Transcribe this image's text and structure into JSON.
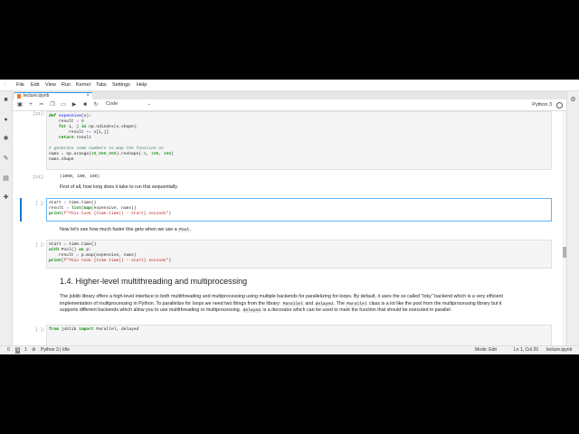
{
  "menubar": {
    "items": [
      "File",
      "Edit",
      "View",
      "Run",
      "Kernel",
      "Tabs",
      "Settings",
      "Help"
    ]
  },
  "tab": {
    "label": "lecture.ipynb",
    "close": "×"
  },
  "toolbar": {
    "cell_type": "Code",
    "kernel": "Python 3"
  },
  "cells": {
    "c1_prompt": "[22]:",
    "c1_out_prompt": "[22]:",
    "c1_output": "(1000, 100, 100)",
    "md1": "First of all, how long does it take to run this sequentially.",
    "c2_prompt": "[ ]:",
    "md2_pre": "Now let's see how much faster this gets when we use a",
    "md2_code": "Pool",
    "md2_post": ".",
    "c3_prompt": "[ ]:",
    "heading": "1.4. Higher-level multithreading and multiprocessing",
    "p1": "The joblib library offers a high-level interface to both multithreading and multiprocessing using multiple backends for parallelizing for-loops. By default, it uses the so called \"loky\" backend which is a very efficient",
    "p2_pre": "implementation of multiprocessing in Python. To parallelize for loops we need two things from the library:",
    "p2_code1": "Parallel",
    "p2_and": "and",
    "p2_code2": "delayed",
    "p2_mid": ". The",
    "p2_code3": "Parallel",
    "p2_post": "class is a lot like the pool from the multiprocessing library but it",
    "p3_pre": "supports different backends which allow you to use multithreading or multiprocessing.",
    "p3_code": "delayed",
    "p3_post": "is a decorator which can be used to mark the function that should be executed in parallel.",
    "c4_prompt": "[ ]:"
  },
  "status": {
    "zero": "0",
    "s_badge": "S",
    "one": "1",
    "kernel_state": "Python 3 | Idle",
    "mode": "Mode: Edit",
    "position": "Ln 1, Col 20",
    "file": "lecture.ipynb"
  }
}
